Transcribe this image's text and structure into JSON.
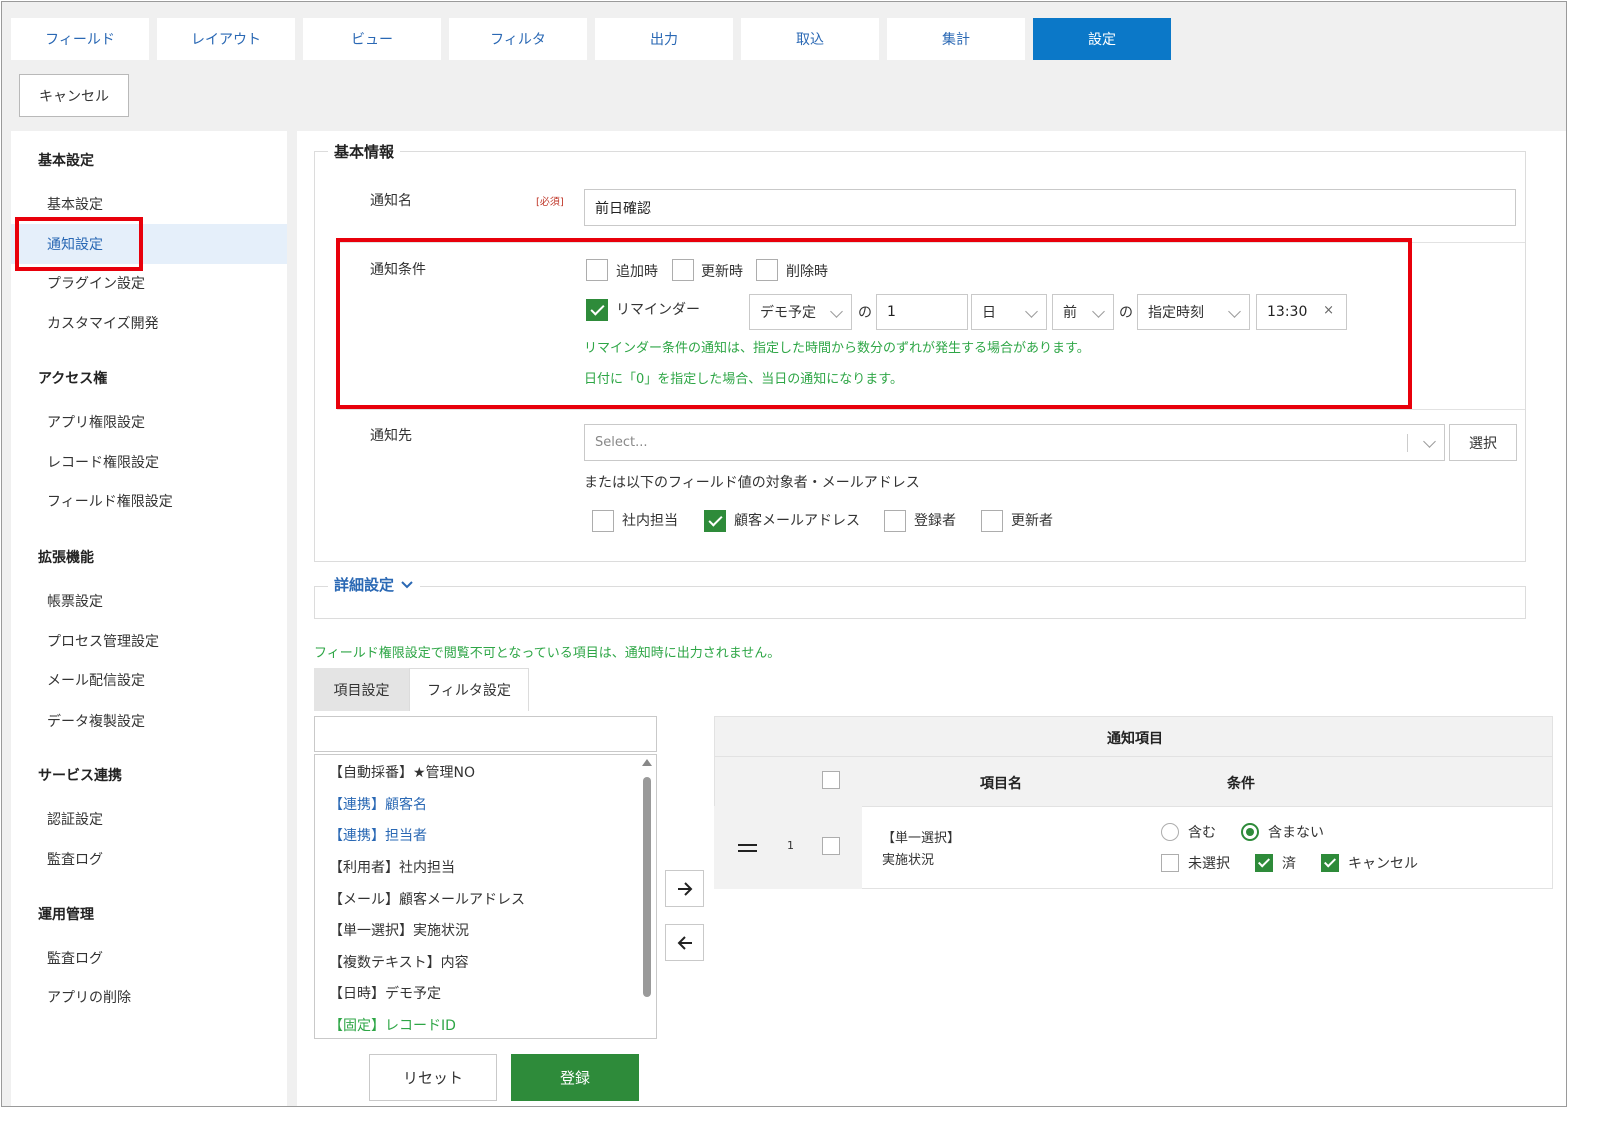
{
  "tabs": [
    "フィールド",
    "レイアウト",
    "ビュー",
    "フィルタ",
    "出力",
    "取込",
    "集計",
    "設定"
  ],
  "cancel_label": "キャンセル",
  "sidebar": {
    "sections": [
      {
        "title": "基本設定",
        "items": [
          "基本設定",
          "通知設定",
          "プラグイン設定",
          "カスタマイズ開発"
        ]
      },
      {
        "title": "アクセス権",
        "items": [
          "アプリ権限設定",
          "レコード権限設定",
          "フィールド権限設定"
        ]
      },
      {
        "title": "拡張機能",
        "items": [
          "帳票設定",
          "プロセス管理設定",
          "メール配信設定",
          "データ複製設定"
        ]
      },
      {
        "title": "サービス連携",
        "items": [
          "認証設定",
          "監査ログ"
        ]
      },
      {
        "title": "運用管理",
        "items": [
          "監査ログ",
          "アプリの削除"
        ]
      }
    ]
  },
  "basic_info": {
    "legend": "基本情報",
    "name_label": "通知名",
    "required": "[必須]",
    "name_value": "前日確認",
    "condition_label": "通知条件",
    "cond_add": "追加時",
    "cond_update": "更新時",
    "cond_delete": "削除時",
    "reminder": "リマインダー",
    "reminder_field": "デモ予定",
    "of1": "の",
    "reminder_num": "1",
    "reminder_unit": "日",
    "reminder_dir": "前",
    "of2": "の",
    "reminder_mode": "指定時刻",
    "reminder_time": "13:30",
    "clear": "×",
    "note1": "リマインダー条件の通知は、指定した時間から数分のずれが発生する場合があります。",
    "note2": "日付に「0」を指定した場合、当日の通知になります。",
    "dest_label": "通知先",
    "dest_placeholder": "Select...",
    "select_btn": "選択",
    "or_text": "または以下のフィールド値の対象者・メールアドレス",
    "dest_opts": [
      "社内担当",
      "顧客メールアドレス",
      "登録者",
      "更新者"
    ]
  },
  "detail_legend": "詳細設定",
  "field_note": "フィールド権限設定で閲覧不可となっている項目は、通知時に出力されません。",
  "subtabs": [
    "項目設定",
    "フィルタ設定"
  ],
  "field_list": [
    "【自動採番】★管理NO",
    "【連携】顧客名",
    "【連携】担当者",
    "【利用者】社内担当",
    "【メール】顧客メールアドレス",
    "【単一選択】実施状況",
    "【複数テキスト】内容",
    "【日時】デモ予定",
    "【固定】レコードID"
  ],
  "notify": {
    "title": "通知項目",
    "col_name": "項目名",
    "col_cond": "条件",
    "row_num": "1",
    "row_field1": "【単一選択】",
    "row_field2": "実施状況",
    "radio_include": "含む",
    "radio_exclude": "含まない",
    "opt_none": "未選択",
    "opt_done": "済",
    "opt_cancel": "キャンセル"
  },
  "reset": "リセット",
  "register": "登録",
  "colors": {
    "accent": "#0b78c8",
    "green": "#2e8b3a",
    "note": "#2ea646",
    "red": "#e8000b"
  }
}
